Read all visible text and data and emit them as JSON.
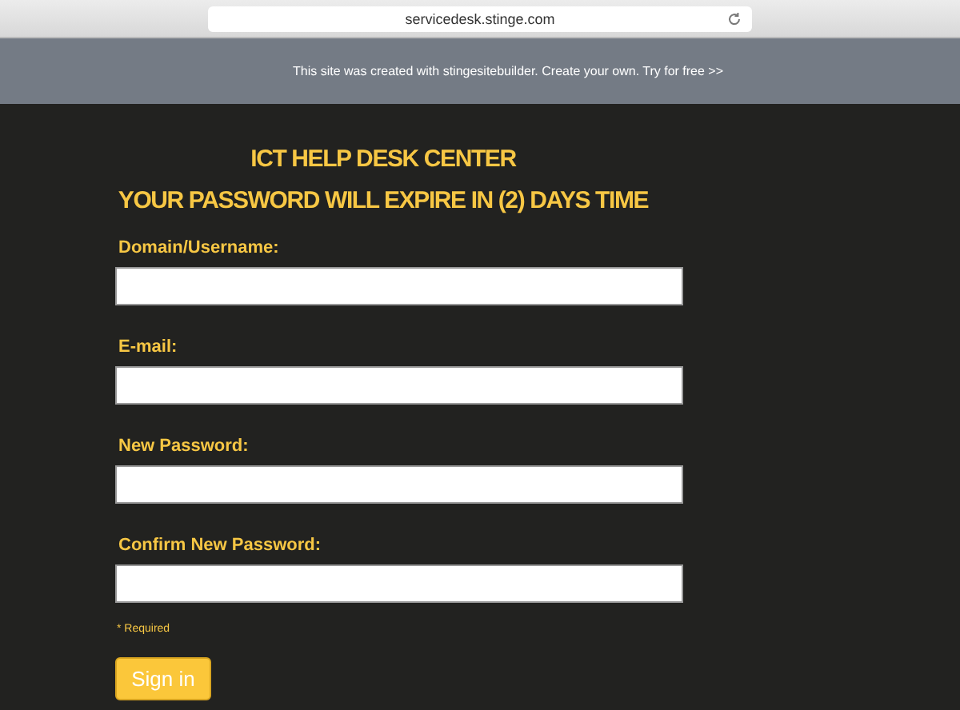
{
  "browser": {
    "url": "servicedesk.stinge.com"
  },
  "banner": {
    "text": "This site was created with stingesitebuilder. Create your own. Try for free >>"
  },
  "heading": {
    "title": "ICT HELP DESK CENTER",
    "subtitle": "YOUR PASSWORD WILL EXPIRE IN (2) DAYS TIME"
  },
  "fields": [
    {
      "label": "Domain/Username:"
    },
    {
      "label": "E-mail:"
    },
    {
      "label": "New Password:"
    },
    {
      "label": "Confirm New Password:"
    }
  ],
  "required_note": "* Required",
  "buttons": [
    "Sign in"
  ]
}
